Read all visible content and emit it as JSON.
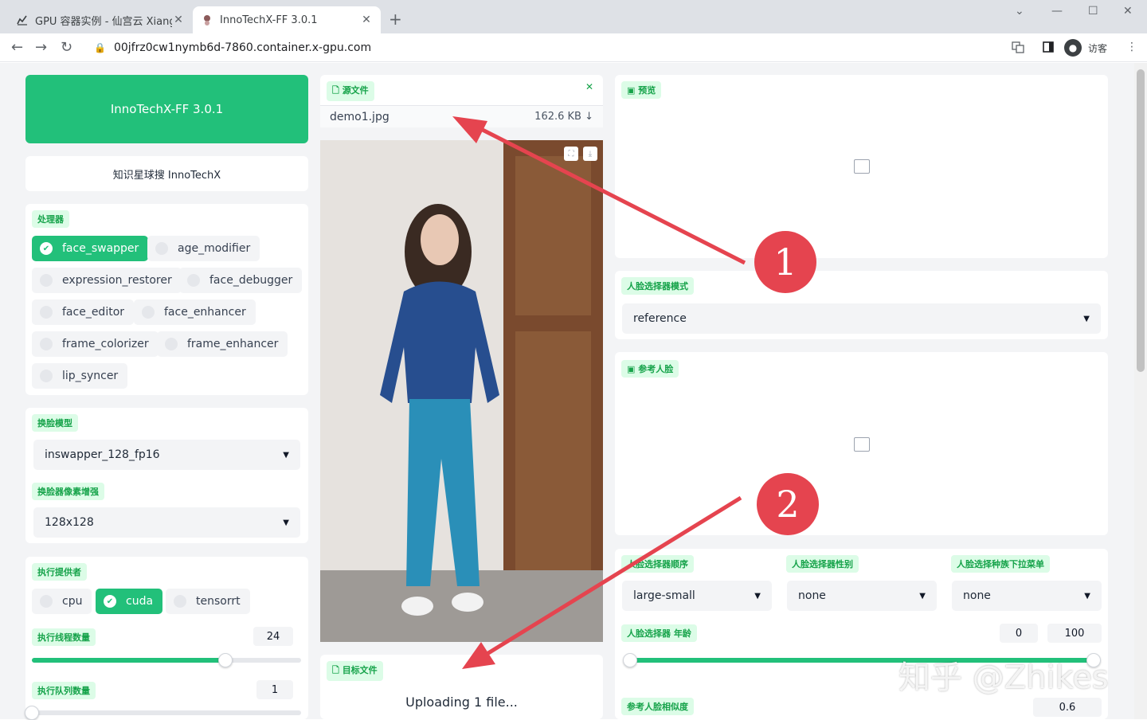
{
  "browser": {
    "tabs": [
      {
        "title": "GPU 容器实例 - 仙宫云 Xiangon",
        "icon": "chart-icon"
      },
      {
        "title": "InnoTechX-FF 3.0.1",
        "icon": "avatar-icon"
      }
    ],
    "address": "00jfrz0cw1nymb6d-7860.container.x-gpu.com",
    "profile_label": "访客"
  },
  "app": {
    "title": "InnoTechX-FF 3.0.1",
    "subtitle": "知识星球搜 InnoTechX"
  },
  "processors": {
    "label": "处理器",
    "items": [
      {
        "name": "face_swapper",
        "checked": true
      },
      {
        "name": "age_modifier",
        "checked": false
      },
      {
        "name": "expression_restorer",
        "checked": false
      },
      {
        "name": "face_debugger",
        "checked": false
      },
      {
        "name": "face_editor",
        "checked": false
      },
      {
        "name": "face_enhancer",
        "checked": false
      },
      {
        "name": "frame_colorizer",
        "checked": false
      },
      {
        "name": "frame_enhancer",
        "checked": false
      },
      {
        "name": "lip_syncer",
        "checked": false
      }
    ]
  },
  "swap_model": {
    "label": "换脸模型",
    "value": "inswapper_128_fp16"
  },
  "pixel_boost": {
    "label": "换脸器像素增强",
    "value": "128x128"
  },
  "providers": {
    "label": "执行提供者",
    "items": [
      {
        "name": "cpu",
        "checked": false
      },
      {
        "name": "cuda",
        "checked": true
      },
      {
        "name": "tensorrt",
        "checked": false
      }
    ]
  },
  "thread_count": {
    "label": "执行线程数量",
    "value": "24",
    "fraction": 0.72
  },
  "queue_count": {
    "label": "执行队列数量",
    "value": "1",
    "fraction": 0.0
  },
  "source": {
    "label": "源文件",
    "filename": "demo1.jpg",
    "size": "162.6 KB ↓"
  },
  "target": {
    "label": "目标文件",
    "status": "Uploading 1 file..."
  },
  "preview": {
    "label": "预览"
  },
  "face_selector_mode": {
    "label": "人脸选择器模式",
    "value": "reference"
  },
  "reference_face": {
    "label": "参考人脸"
  },
  "face_order": {
    "label": "人脸选择器顺序",
    "value": "large-small"
  },
  "face_gender": {
    "label": "人脸选择器性别",
    "value": "none"
  },
  "face_race": {
    "label": "人脸选择种族下拉菜单",
    "value": "none"
  },
  "face_age": {
    "label": "人脸选择器 年龄",
    "min": "0",
    "max": "100"
  },
  "ref_distance": {
    "label": "参考人脸相似度",
    "value": "0.6"
  },
  "annotations": {
    "marker1": "1",
    "marker2": "2",
    "watermark": "知乎 @Zhikes"
  },
  "colors": {
    "accent": "#22c07a",
    "label_bg": "#dcfce7",
    "label_text": "#16a34a",
    "marker": "#e5444f"
  }
}
